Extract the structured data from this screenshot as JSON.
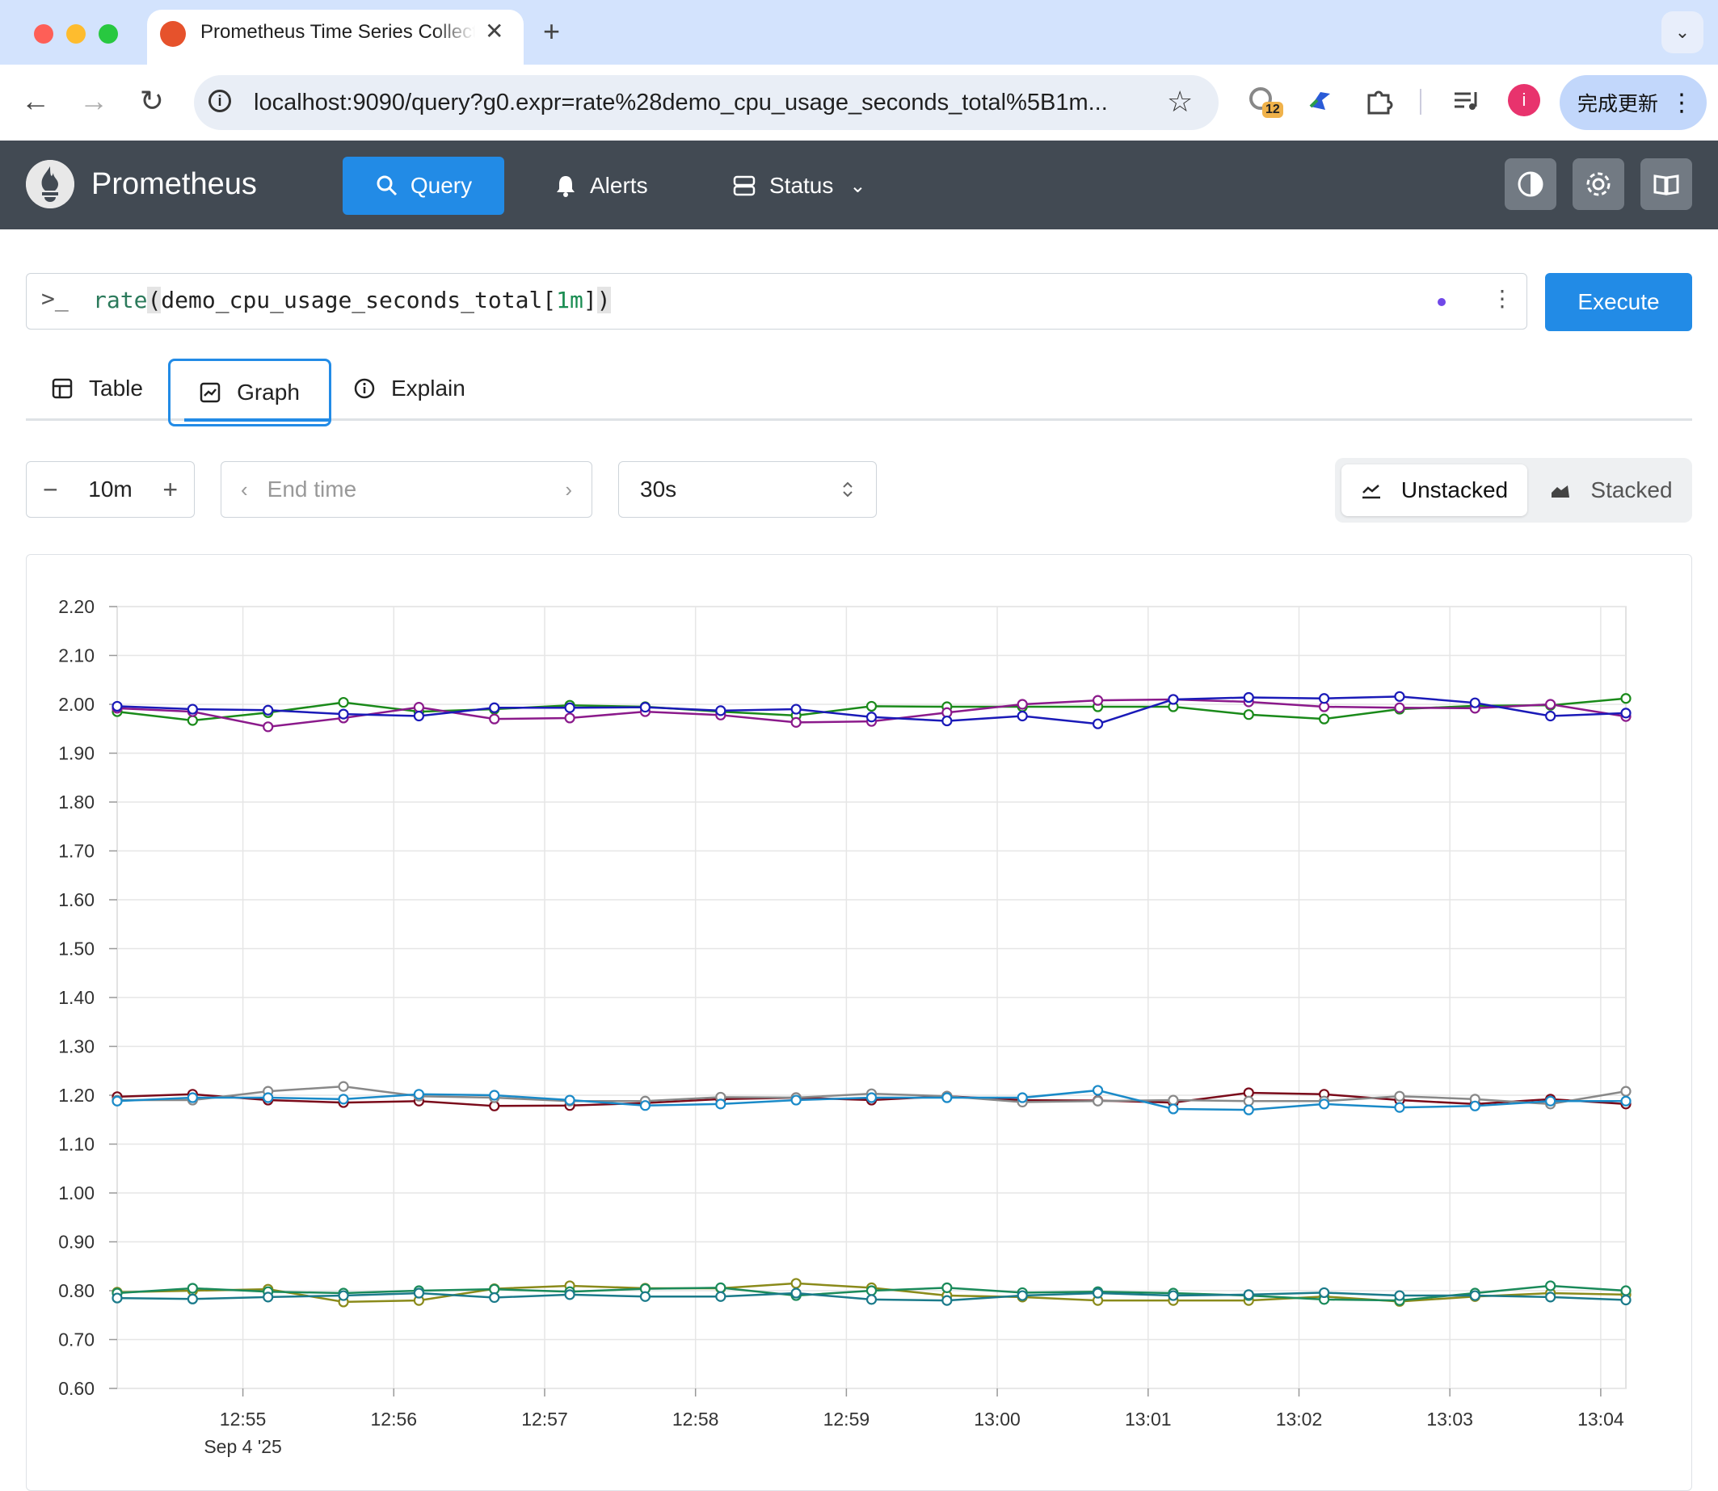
{
  "browser": {
    "tab_title": "Prometheus Time Series Collection and Processing Server",
    "url": "localhost:9090/query?g0.expr=rate%28demo_cpu_usage_seconds_total%5B1m...",
    "extension_badge": "12",
    "profile_initial": "i",
    "update_label": "完成更新",
    "icons": [
      "back-icon",
      "forward-icon",
      "reload-icon",
      "site-info-icon",
      "star-icon",
      "extensions-icon",
      "media-icon",
      "menu-icon"
    ]
  },
  "navbar": {
    "brand": "Prometheus",
    "query": "Query",
    "alerts": "Alerts",
    "status": "Status"
  },
  "query": {
    "expr_fn": "rate",
    "expr_open": "(",
    "expr_metric": "demo_cpu_usage_seconds_total[",
    "expr_range": "1m",
    "expr_close_bracket": "]",
    "expr_close_paren": ")",
    "execute": "Execute"
  },
  "tabs": {
    "table": "Table",
    "graph": "Graph",
    "explain": "Explain",
    "active": "Graph"
  },
  "controls": {
    "range": "10m",
    "end_time_placeholder": "End time",
    "resolution": "30s",
    "unstacked": "Unstacked",
    "stacked": "Stacked",
    "selected_mode": "Unstacked"
  },
  "chart_data": {
    "type": "line",
    "x_tick_labels": [
      "12:55",
      "12:56",
      "12:57",
      "12:58",
      "12:59",
      "13:00",
      "13:01",
      "13:02",
      "13:03",
      "13:04"
    ],
    "x_date_label": "Sep 4 '25",
    "y_tick_labels": [
      "2.20",
      "2.10",
      "2.00",
      "1.90",
      "1.80",
      "1.70",
      "1.60",
      "1.50",
      "1.40",
      "1.30",
      "1.20",
      "1.10",
      "1.00",
      "0.90",
      "0.80",
      "0.70",
      "0.60"
    ],
    "ylim": [
      0.6,
      2.2
    ],
    "x_times": [
      "12:54:10",
      "12:54:40",
      "12:55:10",
      "12:55:40",
      "12:56:10",
      "12:56:40",
      "12:57:10",
      "12:57:40",
      "12:58:10",
      "12:58:40",
      "12:59:10",
      "12:59:40",
      "13:00:10",
      "13:00:40",
      "13:01:10",
      "13:01:40",
      "13:02:10",
      "13:02:40",
      "13:03:10",
      "13:03:40",
      "13:04:10"
    ],
    "grid": true,
    "legend": "none",
    "series": [
      {
        "color": "#1a8a1a",
        "values": [
          1.985,
          1.967,
          1.983,
          2.004,
          1.985,
          1.99,
          1.998,
          1.995,
          1.985,
          1.977,
          1.996,
          1.995,
          1.995,
          1.995,
          1.995,
          1.979,
          1.97,
          1.99,
          1.997,
          1.998,
          2.012
        ]
      },
      {
        "color": "#8b1a8b",
        "values": [
          1.992,
          1.985,
          1.954,
          1.972,
          1.994,
          1.97,
          1.972,
          1.985,
          1.978,
          1.963,
          1.965,
          1.983,
          2.0,
          2.008,
          2.01,
          2.005,
          1.995,
          1.993,
          1.992,
          2.0,
          1.975
        ]
      },
      {
        "color": "#1a1ab8",
        "values": [
          1.996,
          1.99,
          1.988,
          1.98,
          1.976,
          1.993,
          1.993,
          1.994,
          1.987,
          1.99,
          1.974,
          1.966,
          1.976,
          1.96,
          2.01,
          2.014,
          2.012,
          2.016,
          2.003,
          1.976,
          1.982
        ]
      },
      {
        "color": "#7a0a1a",
        "values": [
          1.197,
          1.202,
          1.19,
          1.185,
          1.188,
          1.178,
          1.179,
          1.184,
          1.192,
          1.195,
          1.19,
          1.198,
          1.19,
          1.189,
          1.185,
          1.205,
          1.202,
          1.19,
          1.182,
          1.192,
          1.182
        ]
      },
      {
        "color": "#888888",
        "values": [
          1.19,
          1.19,
          1.208,
          1.218,
          1.198,
          1.195,
          1.188,
          1.188,
          1.196,
          1.195,
          1.203,
          1.198,
          1.186,
          1.188,
          1.19,
          1.188,
          1.188,
          1.198,
          1.192,
          1.182,
          1.208
        ]
      },
      {
        "color": "#1a8ac8",
        "values": [
          1.188,
          1.195,
          1.195,
          1.192,
          1.202,
          1.2,
          1.19,
          1.179,
          1.182,
          1.19,
          1.195,
          1.195,
          1.195,
          1.21,
          1.172,
          1.17,
          1.182,
          1.175,
          1.178,
          1.188,
          1.188
        ]
      },
      {
        "color": "#8a8a1a",
        "values": [
          0.797,
          0.8,
          0.803,
          0.777,
          0.78,
          0.804,
          0.81,
          0.805,
          0.805,
          0.815,
          0.806,
          0.79,
          0.787,
          0.78,
          0.78,
          0.78,
          0.788,
          0.778,
          0.788,
          0.795,
          0.792
        ]
      },
      {
        "color": "#1a8a5a",
        "values": [
          0.795,
          0.805,
          0.798,
          0.795,
          0.8,
          0.803,
          0.798,
          0.804,
          0.806,
          0.79,
          0.8,
          0.806,
          0.796,
          0.798,
          0.795,
          0.79,
          0.782,
          0.78,
          0.795,
          0.81,
          0.8
        ]
      },
      {
        "color": "#1a7a8a",
        "values": [
          0.785,
          0.783,
          0.787,
          0.79,
          0.795,
          0.786,
          0.792,
          0.788,
          0.788,
          0.795,
          0.782,
          0.78,
          0.79,
          0.795,
          0.79,
          0.792,
          0.796,
          0.79,
          0.79,
          0.787,
          0.781
        ]
      }
    ]
  }
}
